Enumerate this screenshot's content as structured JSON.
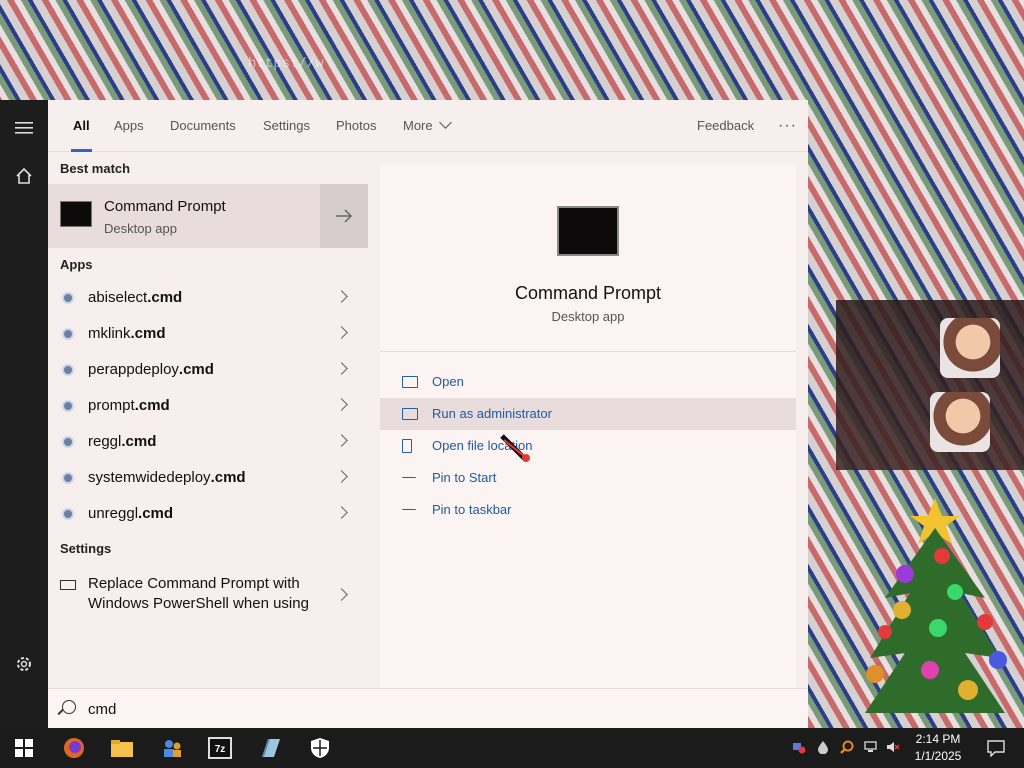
{
  "desktop": {
    "url_text": "https://w"
  },
  "tabs": [
    {
      "label": "All",
      "active": true
    },
    {
      "label": "Apps"
    },
    {
      "label": "Documents"
    },
    {
      "label": "Settings"
    },
    {
      "label": "Photos"
    },
    {
      "label": "More"
    }
  ],
  "feedback_label": "Feedback",
  "more_options_label": "···",
  "left": {
    "best_match_heading": "Best match",
    "best_match": {
      "title": "Command Prompt",
      "subtitle": "Desktop app"
    },
    "apps_heading": "Apps",
    "apps": [
      {
        "name": "abiselect",
        "ext": ".cmd"
      },
      {
        "name": "mklink",
        "ext": ".cmd"
      },
      {
        "name": "perappdeploy",
        "ext": ".cmd"
      },
      {
        "name": "prompt",
        "ext": ".cmd"
      },
      {
        "name": "reggl",
        "ext": ".cmd"
      },
      {
        "name": "systemwidedeploy",
        "ext": ".cmd"
      },
      {
        "name": "unreggl",
        "ext": ".cmd"
      }
    ],
    "settings_heading": "Settings",
    "settings_item": "Replace Command Prompt with Windows PowerShell when using"
  },
  "right": {
    "title": "Command Prompt",
    "subtitle": "Desktop app",
    "actions": [
      {
        "label": "Open"
      },
      {
        "label": "Run as administrator",
        "hover": true
      },
      {
        "label": "Open file location"
      },
      {
        "label": "Pin to Start"
      },
      {
        "label": "Pin to taskbar"
      }
    ]
  },
  "search": {
    "value": "cmd"
  },
  "taskbar": {
    "time": "2:14 PM",
    "date": "1/1/2025",
    "seven_zip_label": "7z"
  },
  "colors": {
    "accent": "#2a68c8",
    "link": "#1f5aa6",
    "taskbar": "#1b1b1b",
    "panel": "#f7efee"
  }
}
